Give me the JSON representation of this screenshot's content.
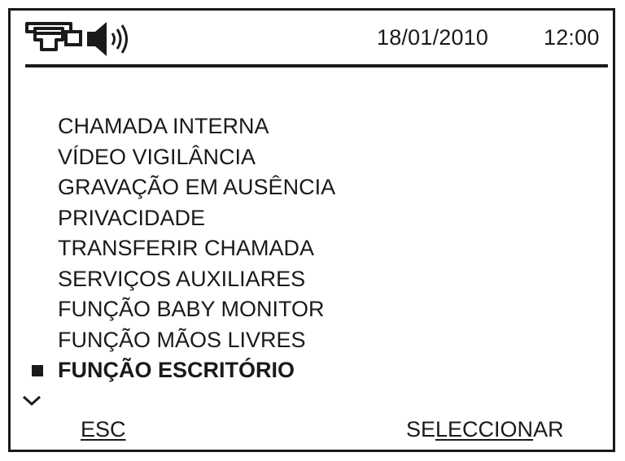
{
  "status_bar": {
    "phone_icon": "intercom-phone-icon",
    "speaker_icon": "speaker-volume-icon",
    "date": "18/01/2010",
    "time": "12:00"
  },
  "menu": {
    "items": [
      {
        "label": "CHAMADA INTERNA",
        "selected": false
      },
      {
        "label": "VÍDEO VIGILÂNCIA",
        "selected": false
      },
      {
        "label": "GRAVAÇÃO EM AUSÊNCIA",
        "selected": false
      },
      {
        "label": "PRIVACIDADE",
        "selected": false
      },
      {
        "label": "TRANSFERIR CHAMADA",
        "selected": false
      },
      {
        "label": "SERVIÇOS AUXILIARES",
        "selected": false
      },
      {
        "label": "FUNÇÃO BABY MONITOR",
        "selected": false
      },
      {
        "label": "FUNÇÃO MÃOS LIVRES",
        "selected": false
      },
      {
        "label": "FUNÇÃO ESCRITÓRIO",
        "selected": true
      }
    ],
    "more_indicator": "chevron-down-icon"
  },
  "softkeys": {
    "left": "ESC",
    "right_parts": [
      "SE",
      "LECCION",
      "AR"
    ]
  },
  "colors": {
    "ink": "#1a1a1a",
    "background": "#ffffff"
  }
}
